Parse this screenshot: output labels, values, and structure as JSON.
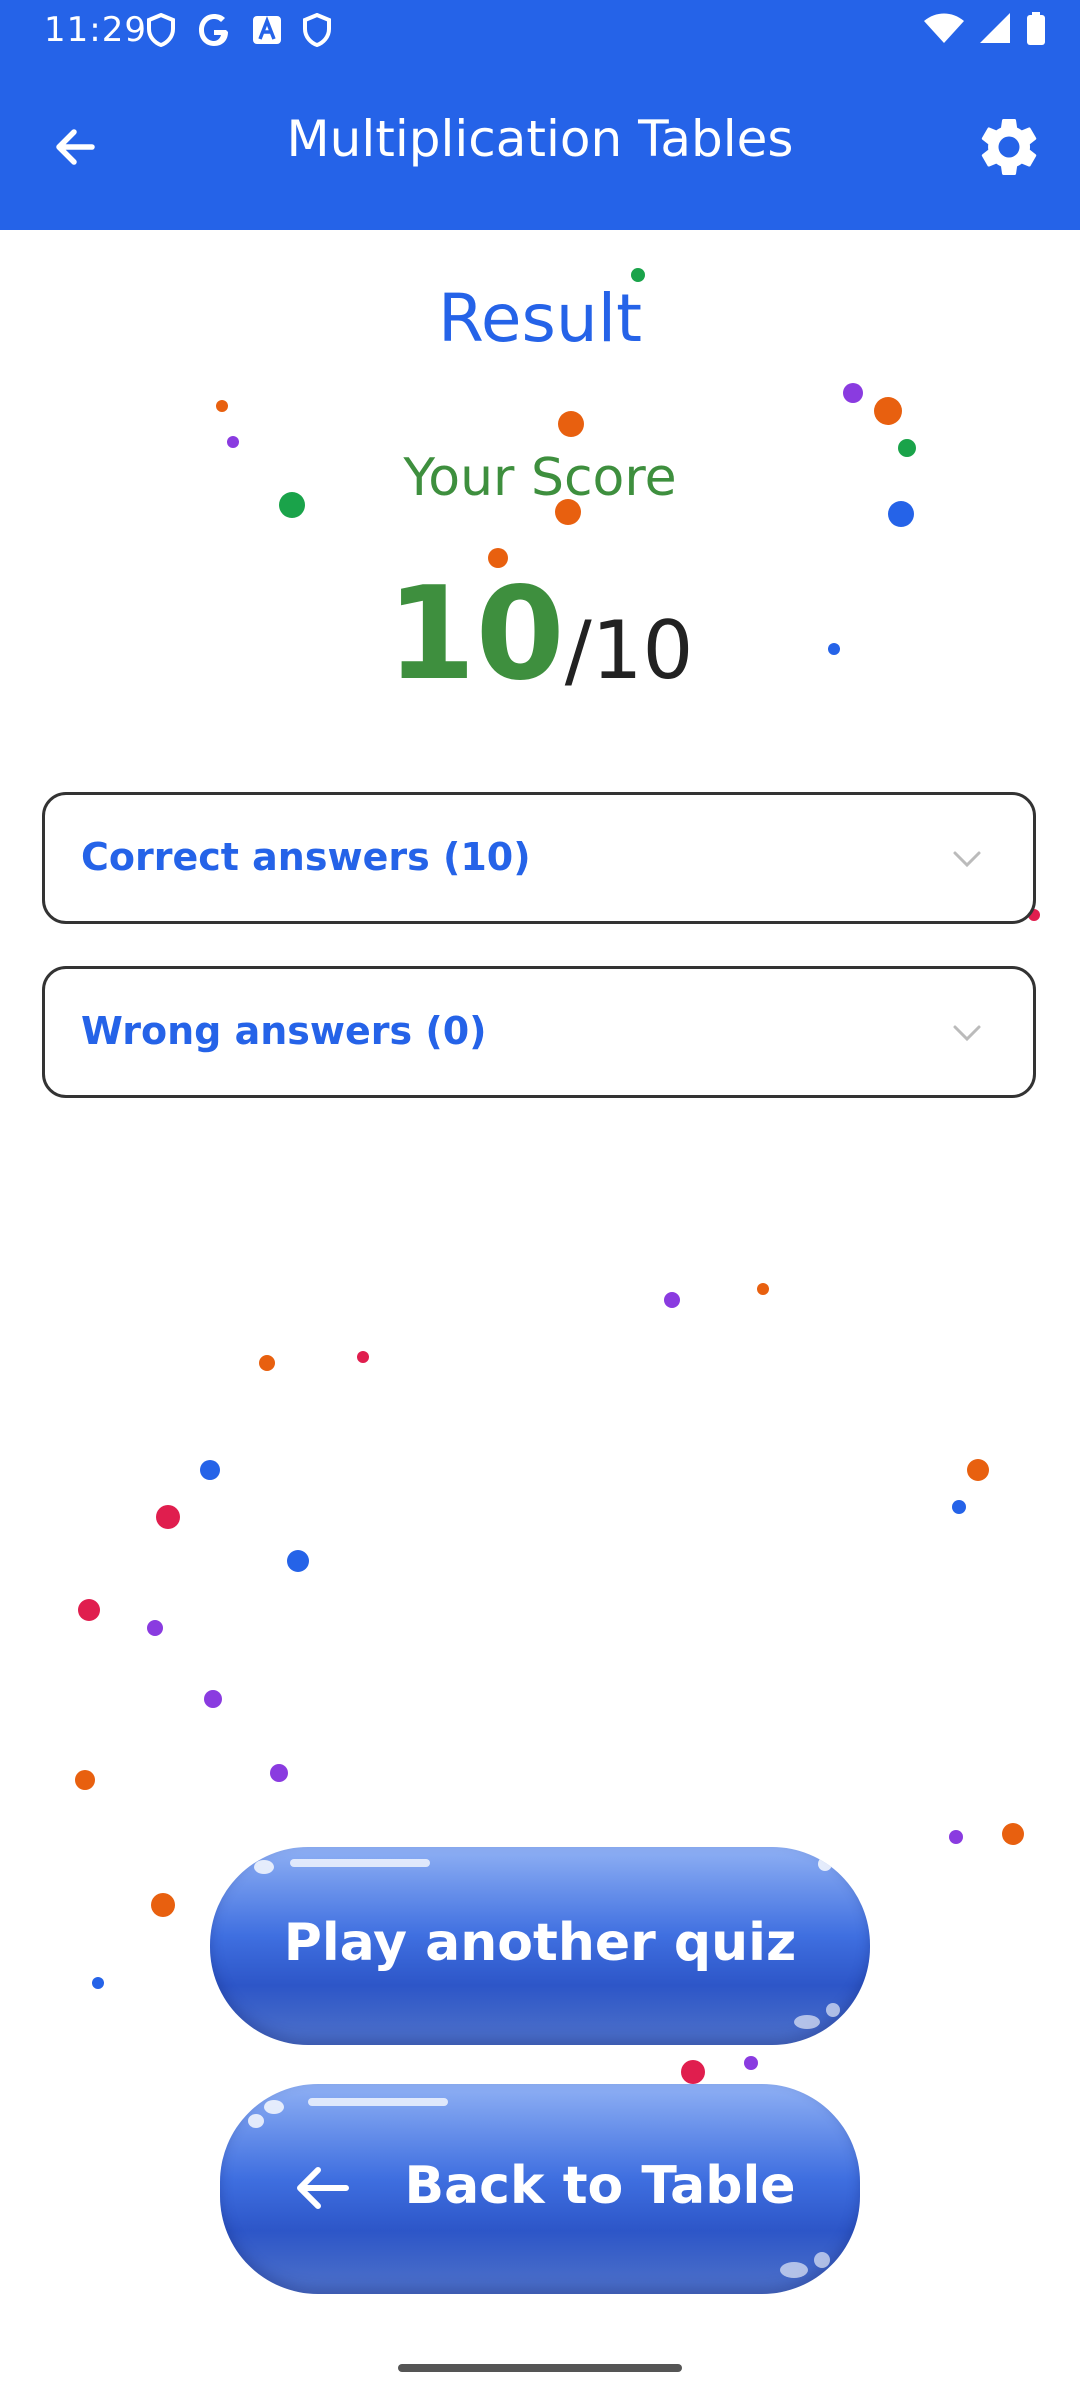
{
  "status_bar": {
    "time": "11:29",
    "left_icons": [
      "shield-icon",
      "google-g-icon",
      "app-a-icon",
      "shield-icon"
    ],
    "right_icons": [
      "wifi-icon",
      "signal-icon",
      "battery-icon"
    ]
  },
  "app_bar": {
    "title": "Multiplication Tables",
    "back_icon": "arrow-left-icon",
    "settings_icon": "gear-icon",
    "background": "#2563e8"
  },
  "result": {
    "heading": "Result",
    "your_score_label": "Your Score",
    "score": "10",
    "total": "/10"
  },
  "answers": {
    "correct_label": "Correct answers (10)",
    "wrong_label": "Wrong answers (0)"
  },
  "buttons": {
    "play_again": "Play another quiz",
    "back_to_table": "Back to Table"
  },
  "colors": {
    "primary": "#2563e8",
    "score_green": "#3e8f3e",
    "confetti": [
      "#e8600f",
      "#8a3be0",
      "#1aa34a",
      "#2563e8",
      "#e01e4e"
    ]
  }
}
